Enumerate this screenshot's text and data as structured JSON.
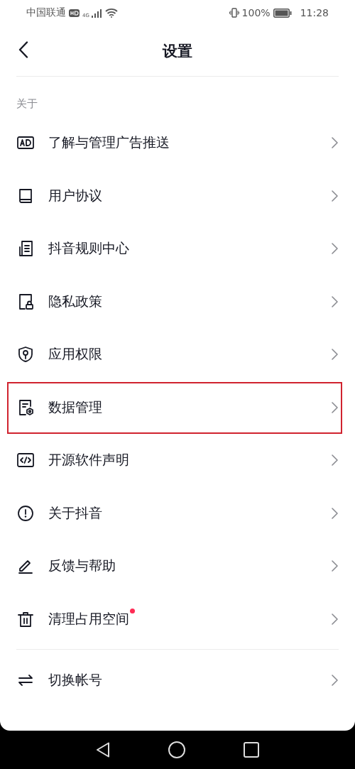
{
  "status_bar": {
    "carrier": "中国联通",
    "network": "4G",
    "battery": "100%",
    "time": "11:28"
  },
  "header": {
    "title": "设置"
  },
  "section": {
    "label": "关于"
  },
  "items": [
    {
      "kind": "ad",
      "label": "了解与管理广告推送",
      "highlighted": false,
      "dot": false
    },
    {
      "kind": "book",
      "label": "用户协议",
      "highlighted": false,
      "dot": false
    },
    {
      "kind": "doc",
      "label": "抖音规则中心",
      "highlighted": false,
      "dot": false
    },
    {
      "kind": "lock",
      "label": "隐私政策",
      "highlighted": false,
      "dot": false
    },
    {
      "kind": "shield",
      "label": "应用权限",
      "highlighted": false,
      "dot": false
    },
    {
      "kind": "data",
      "label": "数据管理",
      "highlighted": true,
      "dot": false
    },
    {
      "kind": "code",
      "label": "开源软件声明",
      "highlighted": false,
      "dot": false
    },
    {
      "kind": "info",
      "label": "关于抖音",
      "highlighted": false,
      "dot": false
    },
    {
      "kind": "pen",
      "label": "反馈与帮助",
      "highlighted": false,
      "dot": false
    },
    {
      "kind": "trash",
      "label": "清理占用空间",
      "highlighted": false,
      "dot": true
    }
  ],
  "account_items": [
    {
      "kind": "swap",
      "label": "切换帐号",
      "highlighted": false,
      "dot": false
    }
  ]
}
